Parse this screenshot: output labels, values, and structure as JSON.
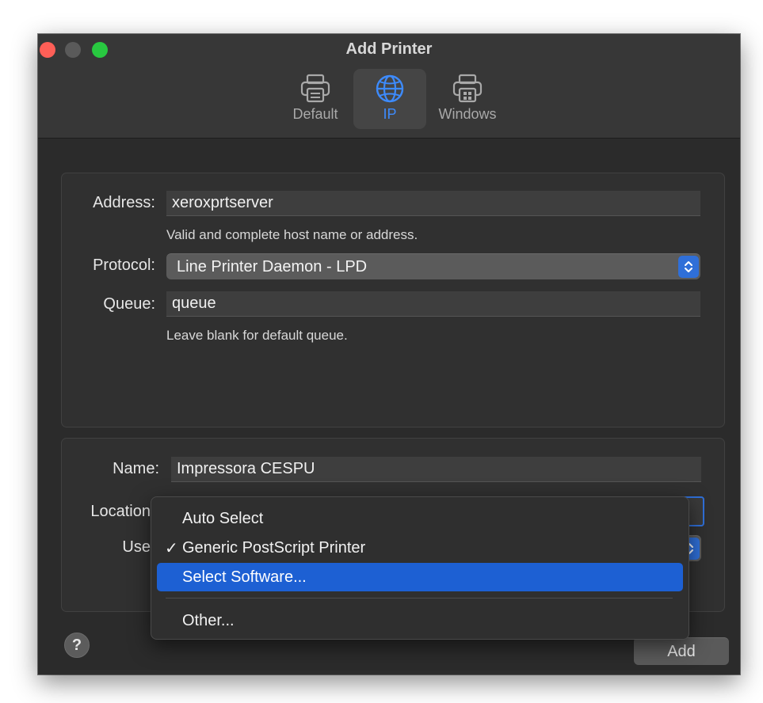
{
  "window": {
    "title": "Add Printer",
    "tabs": [
      {
        "label": "Default",
        "icon": "printer-icon"
      },
      {
        "label": "IP",
        "icon": "globe-icon"
      },
      {
        "label": "Windows",
        "icon": "windows-printer-icon"
      }
    ],
    "active_tab": "IP"
  },
  "ip_panel": {
    "address_label": "Address:",
    "address_value": "xeroxprtserver",
    "address_hint": "Valid and complete host name or address.",
    "protocol_label": "Protocol:",
    "protocol_value": "Line Printer Daemon - LPD",
    "queue_label": "Queue:",
    "queue_value": "queue",
    "queue_hint": "Leave blank for default queue."
  },
  "details_panel": {
    "name_label": "Name:",
    "name_value": "Impressora CESPU",
    "location_label": "Location",
    "use_label": "Use"
  },
  "use_menu": {
    "items": [
      {
        "label": "Auto Select",
        "checked": false,
        "highlighted": false
      },
      {
        "label": "Generic PostScript Printer",
        "checked": true,
        "highlighted": false
      },
      {
        "label": "Select Software...",
        "checked": false,
        "highlighted": true
      },
      {
        "label": "Other...",
        "checked": false,
        "highlighted": false
      }
    ],
    "check_mark": "✓"
  },
  "footer": {
    "help_label": "?",
    "add_label": "Add"
  },
  "colors": {
    "accent": "#3d8bfd",
    "highlight": "#1d60d3",
    "window_bg": "#2b2b2b"
  }
}
